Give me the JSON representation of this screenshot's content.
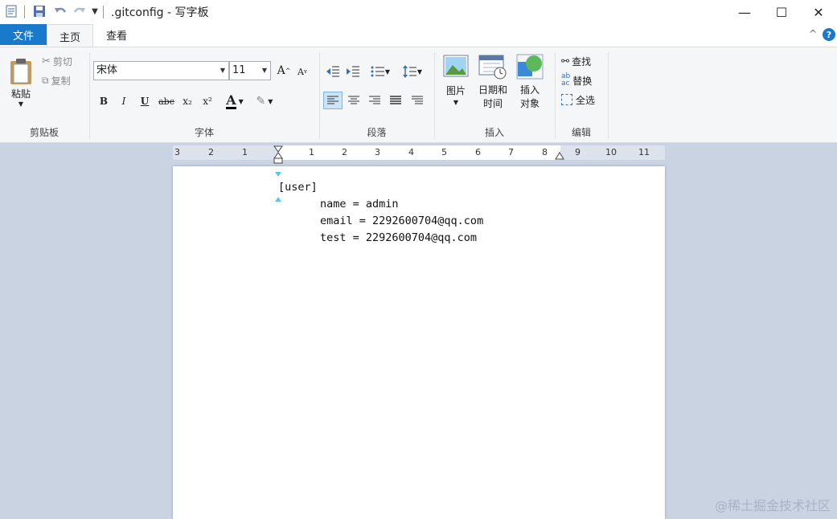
{
  "window": {
    "title": ".gitconfig - 写字板",
    "controls": {
      "minimize": "—",
      "maximize": "☐",
      "close": "✕"
    }
  },
  "tabs": {
    "file": "文件",
    "home": "主页",
    "view": "查看"
  },
  "help": "?",
  "clipboard": {
    "group": "剪贴板",
    "paste": "粘贴",
    "cut": "剪切",
    "copy": "复制"
  },
  "font": {
    "group": "字体",
    "family": "宋体",
    "size": "11",
    "bold": "B",
    "italic": "I",
    "underline": "U",
    "strike": "abc",
    "sub": "x₂",
    "sup": "x²",
    "color_letter": "A"
  },
  "paragraph": {
    "group": "段落"
  },
  "insert": {
    "group": "插入",
    "picture": "图片",
    "datetime_1": "日期和",
    "datetime_2": "时间",
    "object_1": "插入",
    "object_2": "对象"
  },
  "editing": {
    "group": "编辑",
    "find": "查找",
    "replace": "替换",
    "select_all": "全选"
  },
  "ruler": {
    "labels": [
      "3",
      "2",
      "1",
      "1",
      "2",
      "3",
      "4",
      "5",
      "6",
      "7",
      "8",
      "9",
      "10",
      "11"
    ]
  },
  "document": {
    "lines": [
      "[user]",
      "name = admin",
      "email = 2292600704@qq.com",
      "test = 2292600704@qq.com"
    ]
  },
  "watermark": "@稀土掘金技术社区",
  "colors": {
    "file_tab": "#1979ca",
    "ribbon": "#f5f6f7",
    "workspace": "#c9d3e2"
  }
}
